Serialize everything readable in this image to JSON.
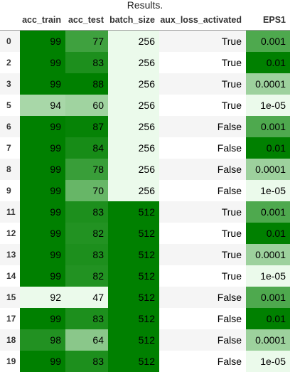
{
  "caption": "Results.",
  "columns": [
    "",
    "acc_train",
    "acc_test",
    "batch_size",
    "aux_loss_activated",
    "EPS1"
  ],
  "rows": [
    {
      "index": "0",
      "acc_train": "99",
      "acc_test": "77",
      "batch_size": "256",
      "aux": "True",
      "eps": "0.001"
    },
    {
      "index": "2",
      "acc_train": "99",
      "acc_test": "83",
      "batch_size": "256",
      "aux": "True",
      "eps": "0.01"
    },
    {
      "index": "3",
      "acc_train": "99",
      "acc_test": "88",
      "batch_size": "256",
      "aux": "True",
      "eps": "0.0001"
    },
    {
      "index": "5",
      "acc_train": "94",
      "acc_test": "60",
      "batch_size": "256",
      "aux": "True",
      "eps": "1e-05"
    },
    {
      "index": "6",
      "acc_train": "99",
      "acc_test": "87",
      "batch_size": "256",
      "aux": "False",
      "eps": "0.001"
    },
    {
      "index": "7",
      "acc_train": "99",
      "acc_test": "84",
      "batch_size": "256",
      "aux": "False",
      "eps": "0.01"
    },
    {
      "index": "8",
      "acc_train": "99",
      "acc_test": "78",
      "batch_size": "256",
      "aux": "False",
      "eps": "0.0001"
    },
    {
      "index": "9",
      "acc_train": "99",
      "acc_test": "70",
      "batch_size": "256",
      "aux": "False",
      "eps": "1e-05"
    },
    {
      "index": "11",
      "acc_train": "99",
      "acc_test": "83",
      "batch_size": "512",
      "aux": "True",
      "eps": "0.001"
    },
    {
      "index": "12",
      "acc_train": "99",
      "acc_test": "82",
      "batch_size": "512",
      "aux": "True",
      "eps": "0.01"
    },
    {
      "index": "13",
      "acc_train": "99",
      "acc_test": "83",
      "batch_size": "512",
      "aux": "True",
      "eps": "0.0001"
    },
    {
      "index": "14",
      "acc_train": "99",
      "acc_test": "82",
      "batch_size": "512",
      "aux": "True",
      "eps": "1e-05"
    },
    {
      "index": "15",
      "acc_train": "92",
      "acc_test": "47",
      "batch_size": "512",
      "aux": "False",
      "eps": "0.001"
    },
    {
      "index": "17",
      "acc_train": "99",
      "acc_test": "83",
      "batch_size": "512",
      "aux": "False",
      "eps": "0.01"
    },
    {
      "index": "18",
      "acc_train": "98",
      "acc_test": "64",
      "batch_size": "512",
      "aux": "False",
      "eps": "0.0001"
    },
    {
      "index": "19",
      "acc_train": "99",
      "acc_test": "83",
      "batch_size": "512",
      "aux": "False",
      "eps": "1e-05"
    }
  ],
  "gradient": {
    "low_color": "#ebfaeb",
    "high_color": "#008000",
    "acc_train_range": [
      92,
      99
    ],
    "acc_test_range": [
      47,
      88
    ],
    "batch_size_range": [
      256,
      512
    ],
    "eps_order": [
      "1e-05",
      "0.0001",
      "0.001",
      "0.01"
    ]
  }
}
